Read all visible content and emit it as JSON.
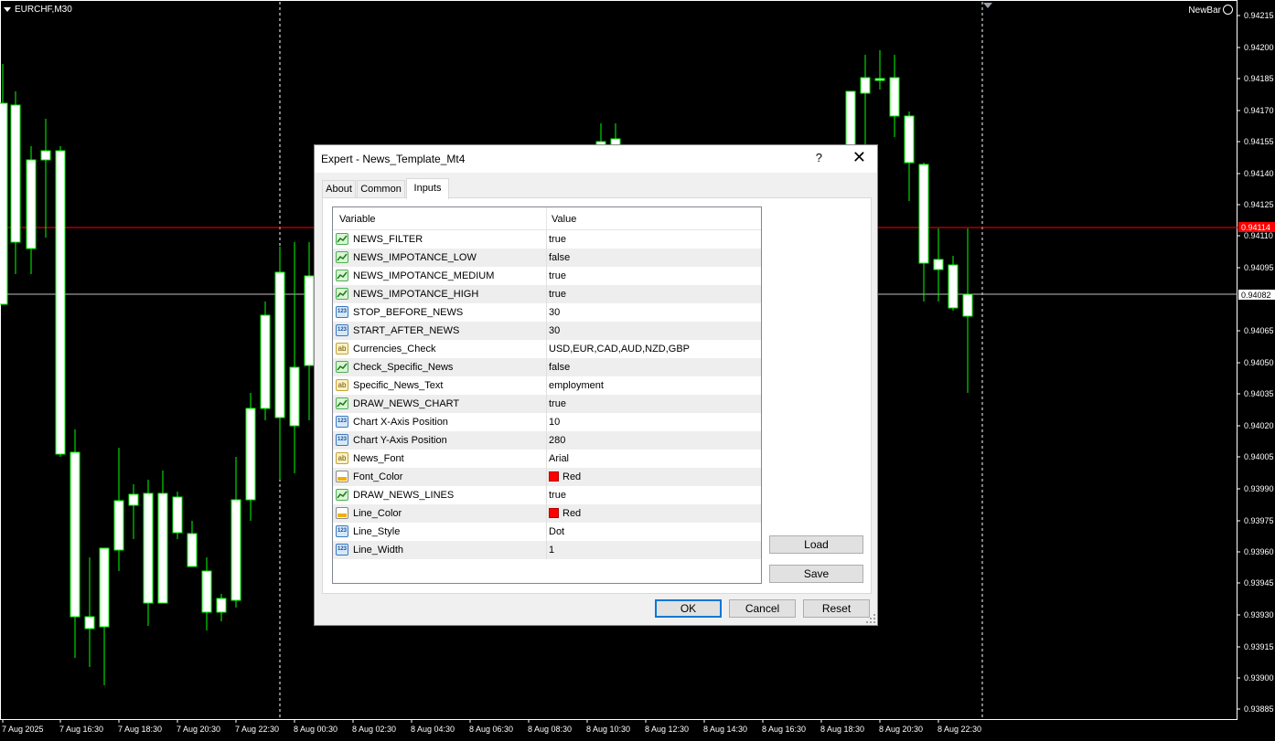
{
  "chart": {
    "symbol": "EURCHF,M30",
    "ea_name": "NewBar",
    "price_labels": [
      "0.94215",
      "0.94200",
      "0.94185",
      "0.94170",
      "0.94155",
      "0.94140",
      "0.94125",
      "0.94110",
      "0.94095",
      "0.94065",
      "0.94050",
      "0.94035",
      "0.94020",
      "0.94005",
      "0.93990",
      "0.93975",
      "0.93960",
      "0.93945",
      "0.93930",
      "0.93915",
      "0.93900",
      "0.93885"
    ],
    "bid_label": "0.94114",
    "ask_label": "0.94082",
    "time_labels": [
      "7 Aug 2025",
      "7 Aug 16:30",
      "7 Aug 18:30",
      "7 Aug 20:30",
      "7 Aug 22:30",
      "8 Aug 00:30",
      "8 Aug 02:30",
      "8 Aug 04:30",
      "8 Aug 06:30",
      "8 Aug 08:30",
      "8 Aug 10:30",
      "8 Aug 12:30",
      "8 Aug 14:30",
      "8 Aug 16:30",
      "8 Aug 18:30",
      "8 Aug 20:30",
      "8 Aug 22:30"
    ],
    "colors": {
      "bull": "#ffffff",
      "wick": "#00ff00",
      "bid_line": "#ff0000",
      "ask_line": "#c0c0c0",
      "grid": "#ffffff"
    }
  },
  "dialog": {
    "title": "Expert - News_Template_Mt4",
    "help_glyph": "?",
    "close_glyph": "✕",
    "tabs": [
      {
        "label": "About"
      },
      {
        "label": "Common"
      },
      {
        "label": "Inputs",
        "active": true
      }
    ],
    "grid": {
      "col_variable": "Variable",
      "col_value": "Value",
      "rows": [
        {
          "type": "bool",
          "name": "NEWS_FILTER",
          "value": "true"
        },
        {
          "type": "bool",
          "name": "NEWS_IMPOTANCE_LOW",
          "value": "false"
        },
        {
          "type": "bool",
          "name": "NEWS_IMPOTANCE_MEDIUM",
          "value": "true"
        },
        {
          "type": "bool",
          "name": "NEWS_IMPOTANCE_HIGH",
          "value": "true"
        },
        {
          "type": "int",
          "name": "STOP_BEFORE_NEWS",
          "value": "30"
        },
        {
          "type": "int",
          "name": "START_AFTER_NEWS",
          "value": "30"
        },
        {
          "type": "str",
          "name": "Currencies_Check",
          "value": "USD,EUR,CAD,AUD,NZD,GBP"
        },
        {
          "type": "bool",
          "name": "Check_Specific_News",
          "value": "false"
        },
        {
          "type": "str",
          "name": "Specific_News_Text",
          "value": "employment"
        },
        {
          "type": "bool",
          "name": "DRAW_NEWS_CHART",
          "value": "true"
        },
        {
          "type": "int",
          "name": "Chart X-Axis Position",
          "value": "10"
        },
        {
          "type": "int",
          "name": "Chart Y-Axis Position",
          "value": "280"
        },
        {
          "type": "str",
          "name": "News_Font",
          "value": "Arial"
        },
        {
          "type": "color",
          "name": "Font_Color",
          "value": "Red"
        },
        {
          "type": "bool",
          "name": "DRAW_NEWS_LINES",
          "value": "true"
        },
        {
          "type": "color",
          "name": "Line_Color",
          "value": "Red"
        },
        {
          "type": "int",
          "name": "Line_Style",
          "value": "Dot"
        },
        {
          "type": "int",
          "name": "Line_Width",
          "value": "1"
        }
      ]
    },
    "icon_text": {
      "int": "123",
      "str": "ab"
    },
    "buttons": {
      "load": "Load",
      "save": "Save",
      "ok": "OK",
      "cancel": "Cancel",
      "reset": "Reset"
    }
  }
}
